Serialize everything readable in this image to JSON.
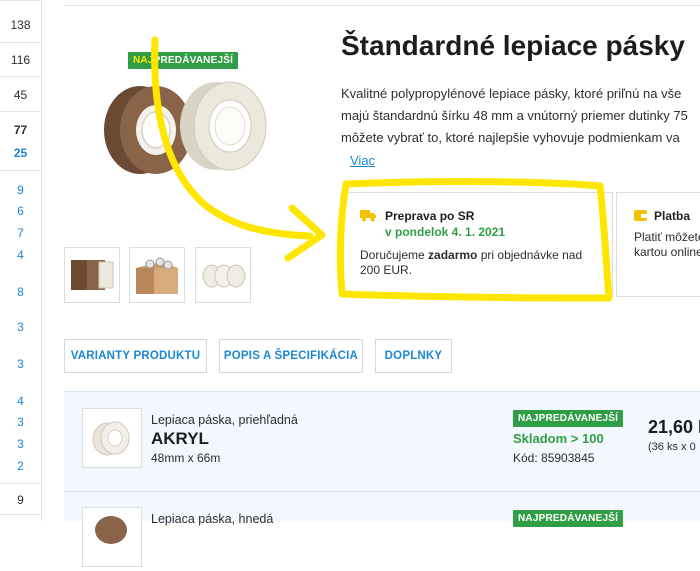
{
  "left_column": {
    "values": [
      "138",
      "116",
      "45",
      "77",
      "25",
      "9",
      "6",
      "7",
      "4",
      "8",
      "3",
      "3",
      "4",
      "3",
      "3",
      "2",
      "9"
    ]
  },
  "product": {
    "badge": {
      "prefix": "NAJ",
      "rest": "PREDÁVANEJŠÍ"
    },
    "title": "Štandardné lepiace pásky",
    "description_lines": [
      "Kvalitné polypropylénové lepiace pásky, ktoré priľnú na vše",
      "majú štandardnú šírku 48 mm a vnútorný priemer dutinky 75",
      "môžete vybrať to, ktoré najlepšie vyhovuje podmienkam va"
    ],
    "more_link": "Viac"
  },
  "shipping": {
    "title": "Preprava po SR",
    "date": "v pondelok 4. 1. 2021",
    "note_before": "Doručujeme ",
    "note_bold": "zadarmo",
    "note_after": " pri objednávke nad",
    "note_line2": "200 EUR."
  },
  "payment": {
    "title": "Platba",
    "note_line1": "Platiť môžete",
    "note_line2": "kartou online"
  },
  "tabs": [
    "VARIANTY PRODUKTU",
    "POPIS A ŠPECIFIKÁCIA",
    "DOPLNKY"
  ],
  "variants": [
    {
      "badge": "NAJPREDÁVANEJŠÍ",
      "subtitle": "Lepiaca páska, priehľadná",
      "name": "AKRYL",
      "dimensions": "48mm x 66m",
      "stock": "Skladom > 100",
      "code": "Kód: 85903845",
      "price": "21,60 E",
      "price_sub": "(36 ks x 0"
    },
    {
      "badge": "NAJPREDÁVANEJŠÍ",
      "subtitle": "Lepiaca páska, hnedá"
    }
  ],
  "colors": {
    "accent_blue": "#1c88d1",
    "green": "#2f9e44",
    "highlight_yellow": "#ffe600"
  }
}
